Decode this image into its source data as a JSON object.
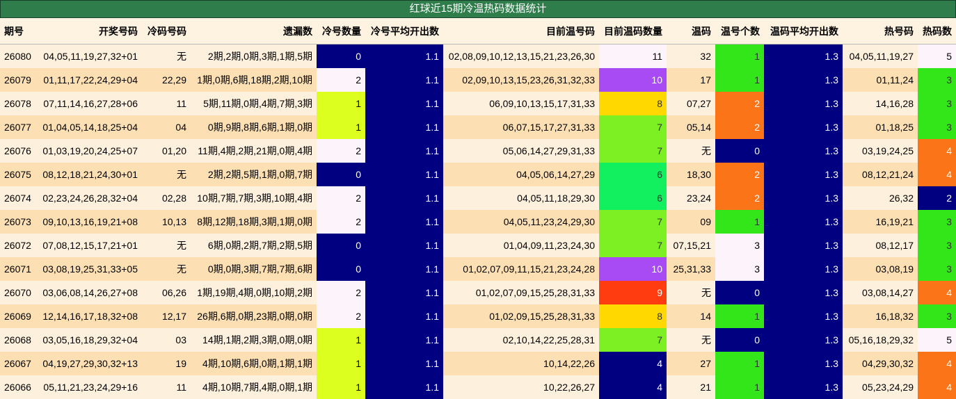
{
  "title": "红球近15期冷温热码数据统计",
  "headers": [
    "期号",
    "开奖号码",
    "冷码号码",
    "遗漏数",
    "冷号数量",
    "冷号平均开出数",
    "目前温号码",
    "目前温码数量",
    "温码",
    "温号个数",
    "温码平均开出数",
    "热号码",
    "热码数"
  ],
  "rows": [
    [
      "26080",
      "04,05,11,19,27,32+01",
      "无",
      "2期,2期,0期,3期,1期,5期",
      "0",
      "1.1",
      "02,08,09,10,12,13,15,21,23,26,30",
      "11",
      "32",
      "1",
      "1.3",
      "04,05,11,19,27",
      "5"
    ],
    [
      "26079",
      "01,11,17,22,24,29+04",
      "22,29",
      "1期,0期,6期,18期,2期,10期",
      "2",
      "1.1",
      "02,09,10,13,15,23,26,31,32,33",
      "10",
      "17",
      "1",
      "1.3",
      "01,11,24",
      "3"
    ],
    [
      "26078",
      "07,11,14,16,27,28+06",
      "11",
      "5期,11期,0期,4期,7期,3期",
      "1",
      "1.1",
      "06,09,10,13,15,17,31,33",
      "8",
      "07,27",
      "2",
      "1.3",
      "14,16,28",
      "3"
    ],
    [
      "26077",
      "01,04,05,14,18,25+04",
      "04",
      "0期,9期,8期,6期,1期,0期",
      "1",
      "1.1",
      "06,07,15,17,27,31,33",
      "7",
      "05,14",
      "2",
      "1.3",
      "01,18,25",
      "3"
    ],
    [
      "26076",
      "01,03,19,20,24,25+07",
      "01,20",
      "11期,4期,2期,21期,0期,4期",
      "2",
      "1.1",
      "05,06,14,27,29,31,33",
      "7",
      "无",
      "0",
      "1.3",
      "03,19,24,25",
      "4"
    ],
    [
      "26075",
      "08,12,18,21,24,30+01",
      "无",
      "2期,2期,5期,1期,0期,7期",
      "0",
      "1.1",
      "04,05,06,14,27,29",
      "6",
      "18,30",
      "2",
      "1.3",
      "08,12,21,24",
      "4"
    ],
    [
      "26074",
      "02,23,24,26,28,32+04",
      "02,28",
      "10期,7期,7期,3期,10期,4期",
      "2",
      "1.1",
      "04,05,11,18,29,30",
      "6",
      "23,24",
      "2",
      "1.3",
      "26,32",
      "2"
    ],
    [
      "26073",
      "09,10,13,16,19,21+08",
      "10,13",
      "8期,12期,18期,3期,1期,0期",
      "2",
      "1.1",
      "04,05,11,23,24,29,30",
      "7",
      "09",
      "1",
      "1.3",
      "16,19,21",
      "3"
    ],
    [
      "26072",
      "07,08,12,15,17,21+01",
      "无",
      "6期,0期,2期,7期,2期,5期",
      "0",
      "1.1",
      "01,04,09,11,23,24,30",
      "7",
      "07,15,21",
      "3",
      "1.3",
      "08,12,17",
      "3"
    ],
    [
      "26071",
      "03,08,19,25,31,33+05",
      "无",
      "0期,0期,3期,7期,7期,6期",
      "0",
      "1.1",
      "01,02,07,09,11,15,21,23,24,28",
      "10",
      "25,31,33",
      "3",
      "1.3",
      "03,08,19",
      "3"
    ],
    [
      "26070",
      "03,06,08,14,26,27+08",
      "06,26",
      "1期,19期,4期,0期,10期,2期",
      "2",
      "1.1",
      "01,02,07,09,15,25,28,31,33",
      "9",
      "无",
      "0",
      "1.3",
      "03,08,14,27",
      "4"
    ],
    [
      "26069",
      "12,14,16,17,18,32+08",
      "12,17",
      "26期,6期,0期,23期,0期,0期",
      "2",
      "1.1",
      "01,02,09,15,25,28,31,33",
      "8",
      "14",
      "1",
      "1.3",
      "16,18,32",
      "3"
    ],
    [
      "26068",
      "03,05,16,18,29,32+04",
      "03",
      "14期,1期,2期,3期,0期,0期",
      "1",
      "1.1",
      "02,10,14,22,25,28,31",
      "7",
      "无",
      "0",
      "1.3",
      "05,16,18,29,32",
      "5"
    ],
    [
      "26067",
      "04,19,27,29,30,32+13",
      "19",
      "4期,10期,6期,0期,1期,1期",
      "1",
      "1.1",
      "10,14,22,26",
      "4",
      "27",
      "1",
      "1.3",
      "04,29,30,32",
      "4"
    ],
    [
      "26066",
      "05,11,21,23,24,29+16",
      "11",
      "4期,10期,7期,4期,0期,1期",
      "1",
      "1.1",
      "10,22,26,27",
      "4",
      "21",
      "1",
      "1.3",
      "05,23,24,29",
      "4"
    ]
  ],
  "colors": {
    "cold_count": {
      "0": "bg-navy",
      "1": "bg-lime",
      "2": "bg-pale"
    },
    "warm_count": {
      "4": "bg-navy",
      "6": "bg-sgreen",
      "7": "bg-ygreen",
      "8": "bg-gold",
      "9": "bg-red",
      "10": "bg-purple",
      "11": "bg-white"
    },
    "warm_num": {
      "0": "bg-navy",
      "1": "bg-green",
      "2": "bg-orange",
      "3": "bg-pale"
    },
    "hot_count": {
      "2": "bg-navy",
      "3": "bg-green",
      "4": "bg-orange",
      "5": "bg-pale"
    }
  }
}
